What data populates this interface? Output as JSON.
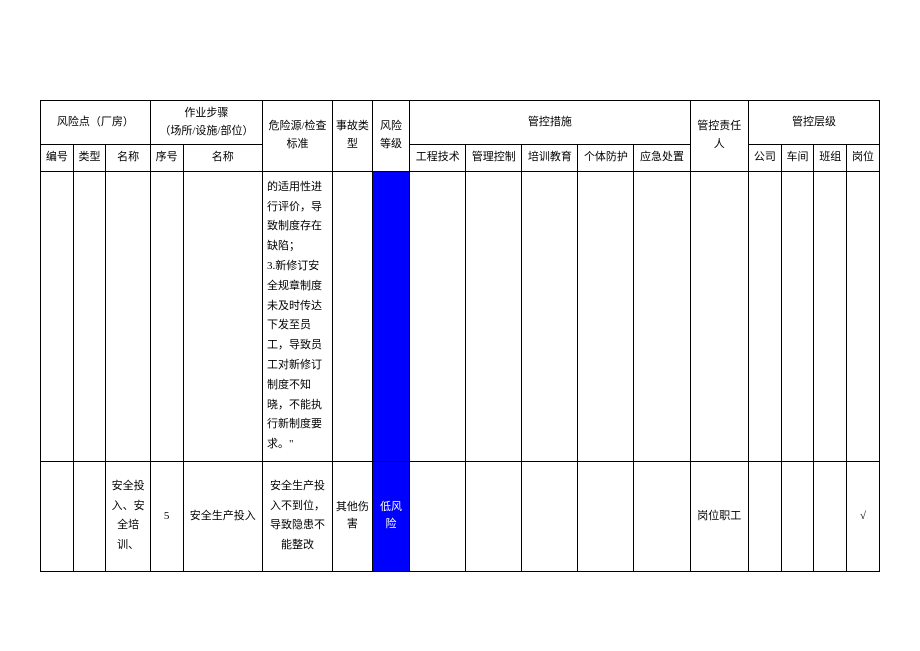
{
  "header": {
    "risk_point": "风险点（厂房）",
    "work_step": "作业步骤\n（场所/设施/部位）",
    "hazard_source": "危险源/检查标准",
    "accident_type": "事故类型",
    "risk_level": "风险等级",
    "control_measures": "管控措施",
    "responsible": "管控责任人",
    "control_level": "管控层级",
    "number": "编号",
    "type": "类型",
    "name": "名称",
    "seq": "序号",
    "step_name": "名称",
    "engineering": "工程技术",
    "management": "管理控制",
    "training": "培训教育",
    "ppe": "个体防护",
    "emergency": "应急处置",
    "company": "公司",
    "workshop": "车间",
    "team": "班组",
    "position": "岗位"
  },
  "rows": {
    "r1": {
      "hazard_text": "的适用性进行评价，导致制度存在缺陷；\n3.新修订安全规章制度未及时传达下发至员工，导致员工对新修订制度不知晓，不能执行新制度要求。\""
    },
    "r2": {
      "name": "安全投入、安全培训、",
      "seq": "5",
      "step_name": "安全生产投入",
      "hazard_text": "安全生产投入不到位，导致隐患不能整改",
      "accident_type": "其他伤害",
      "risk_level": "低风险",
      "responsible": "岗位职工",
      "position_mark": "√"
    }
  }
}
